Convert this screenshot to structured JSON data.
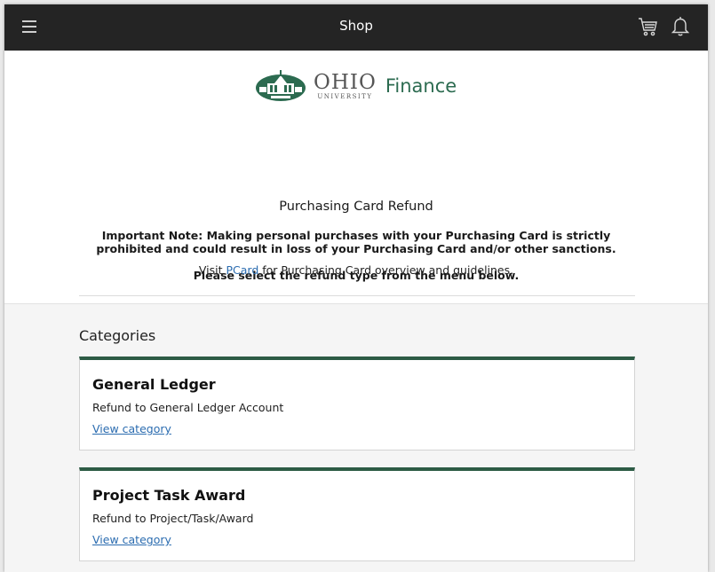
{
  "topbar": {
    "title": "Shop",
    "icons": [
      "menu-icon",
      "cart-icon",
      "bell-icon"
    ]
  },
  "logo": {
    "brand": "OHIO",
    "subtitle": "UNIVERSITY",
    "department": "Finance",
    "accent_color": "#2c6b50"
  },
  "hero": {
    "title": "Purchasing Card Refund",
    "note": "Important Note:  Making personal purchases with your Purchasing Card is strictly prohibited and could result in loss of your Purchasing Card and/or other sanctions.",
    "select_prompt": "Please select the refund type from the menu below.",
    "visit_prefix": "Visit ",
    "visit_link": "PCard",
    "visit_suffix": " for Purchasing Card overview and guidelines."
  },
  "categories": {
    "heading": "Categories",
    "items": [
      {
        "title": "General Ledger",
        "description": "Refund to General Ledger Account",
        "link": "View category"
      },
      {
        "title": "Project Task Award",
        "description": "Refund to Project/Task/Award",
        "link": "View category"
      }
    ],
    "card_accent_color": "#2d5b45"
  }
}
